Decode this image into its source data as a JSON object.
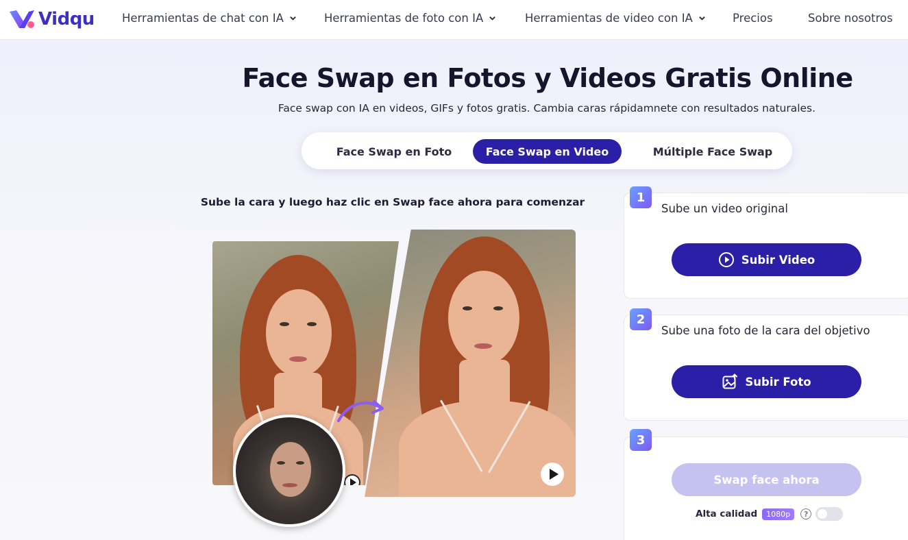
{
  "brand": {
    "name": "Vidqu",
    "color": "#3b2fc9"
  },
  "nav": {
    "items": [
      {
        "label": "Herramientas de chat con IA",
        "has_dropdown": true
      },
      {
        "label": "Herramientas de foto con IA",
        "has_dropdown": true
      },
      {
        "label": "Herramientas de video con IA",
        "has_dropdown": true
      },
      {
        "label": "Precios",
        "has_dropdown": false
      },
      {
        "label": "Sobre nosotros",
        "has_dropdown": false
      }
    ]
  },
  "hero": {
    "title": "Face Swap en Fotos y Videos Gratis Online",
    "subtitle": "Face swap con IA en videos, GIFs y fotos gratis. Cambia caras rápidamnete con resultados naturales."
  },
  "tabs": {
    "items": [
      "Face Swap en Foto",
      "Face Swap en Video",
      "Múltiple Face Swap"
    ],
    "active": "Face Swap en Video"
  },
  "demo": {
    "instruction": "Sube la cara y luego haz clic en Swap face ahora para comenzar"
  },
  "steps": [
    {
      "number": "1",
      "label": "Sube un video original",
      "button": "Subir Video",
      "icon": "play-circle-icon"
    },
    {
      "number": "2",
      "label": "Sube una foto de la cara del objetivo",
      "button": "Subir Foto",
      "icon": "image-upload-icon"
    },
    {
      "number": "3",
      "button": "Swap face ahora"
    }
  ],
  "quality": {
    "label": "Alta calidad",
    "badge": "1080p",
    "help": "?",
    "enabled": false
  },
  "colors": {
    "primary": "#2a1fa6",
    "disabled": "#c6c2f0",
    "accent": "#7b5bf0"
  }
}
